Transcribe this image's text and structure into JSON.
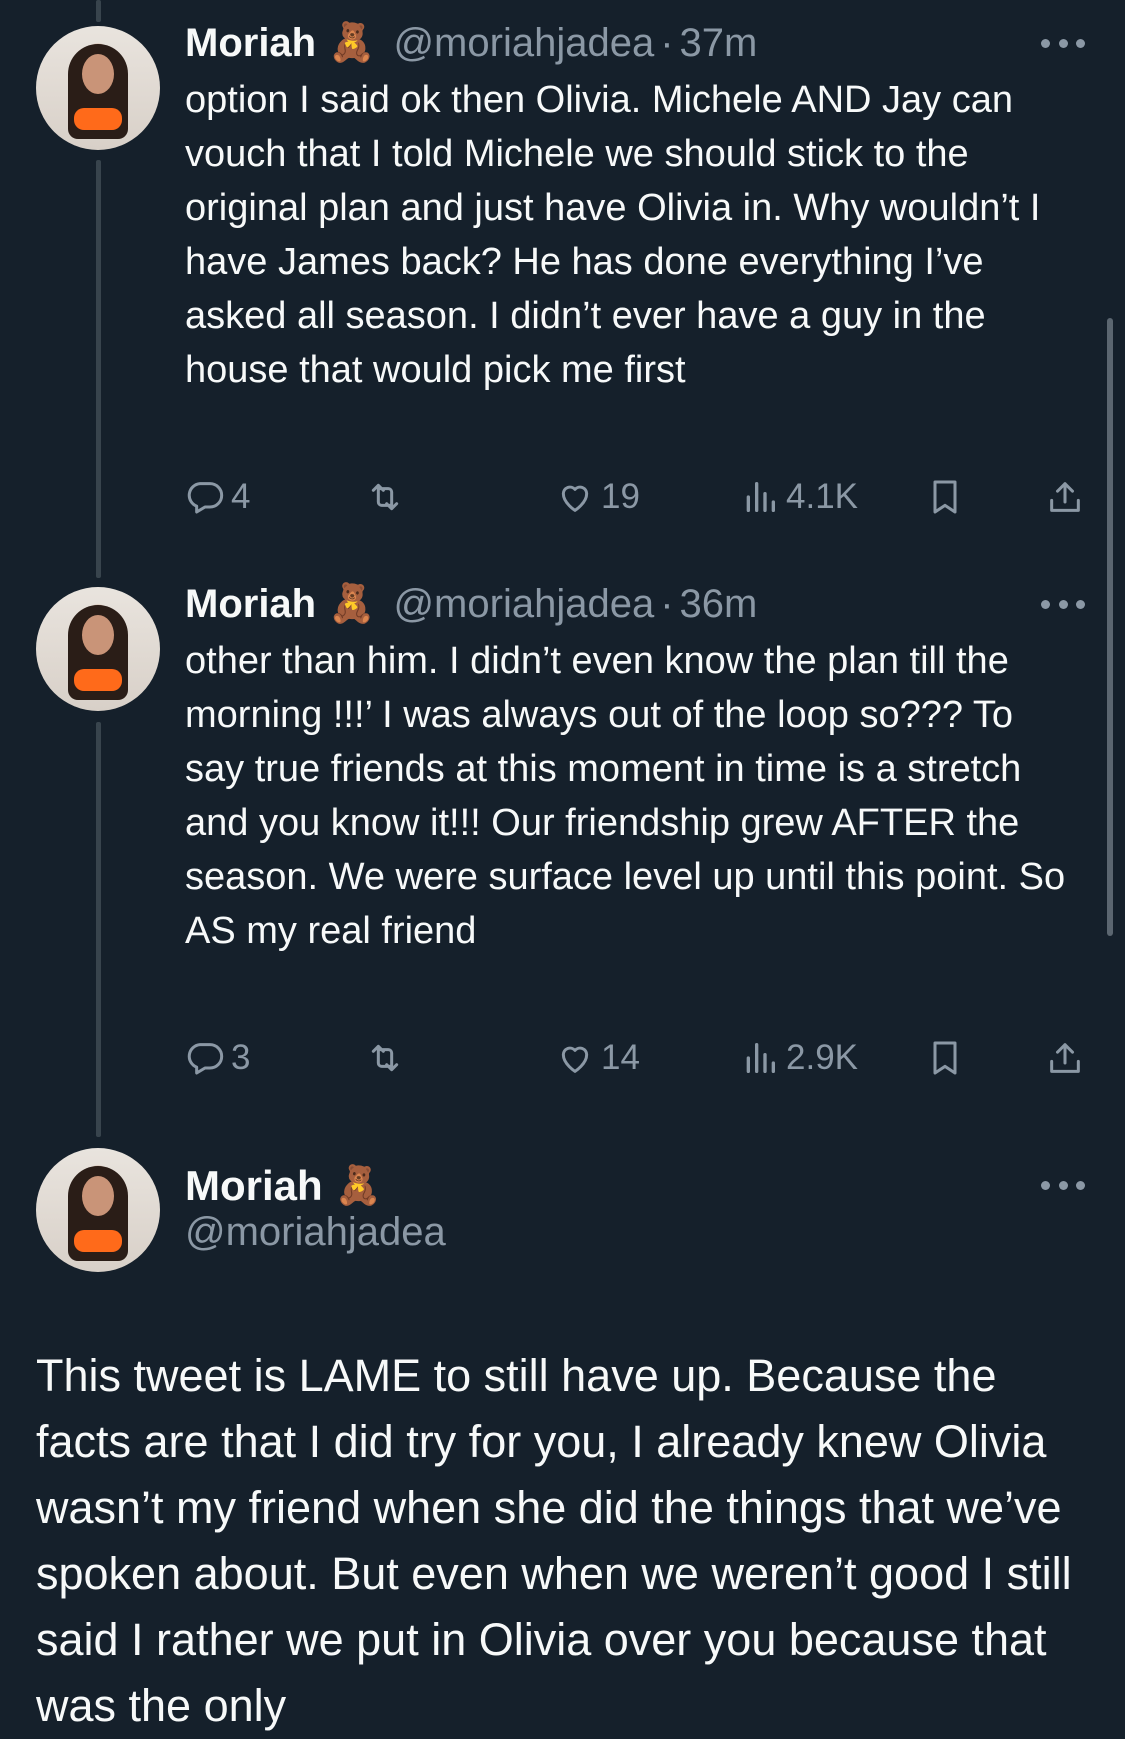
{
  "tweets": [
    {
      "name": "Moriah",
      "emoji": "🧸",
      "handle": "@moriahjadea",
      "separator": "·",
      "time": "37m",
      "text": "option I said ok then Olivia. Michele AND Jay can vouch that I told Michele we should stick to the original plan and just have Olivia in. Why wouldn’t I have James back? He has done everything I’ve asked all season. I didn’t ever have a guy in the house that would pick me first",
      "replies": "4",
      "likes": "19",
      "views": "4.1K"
    },
    {
      "name": "Moriah",
      "emoji": "🧸",
      "handle": "@moriahjadea",
      "separator": "·",
      "time": "36m",
      "text": "other than him. I didn’t even know the plan till the morning !!!’ I was always out of the loop so??? To say true friends at this moment in time is a stretch and you know it!!! Our friendship grew AFTER the season. We were surface level up until this point. So AS my real friend",
      "replies": "3",
      "likes": "14",
      "views": "2.9K"
    }
  ],
  "main_tweet": {
    "name": "Moriah",
    "emoji": "🧸",
    "handle": "@moriahjadea",
    "text": "This tweet is LAME to still have up. Because the facts are that I did try for you, I already knew Olivia wasn’t my friend when she did the things that we’ve spoken about. But even when we weren’t good I still said I rather we put in Olivia over you because that was the only"
  },
  "icons": {
    "reply": "reply-icon",
    "retweet": "retweet-icon",
    "like": "heart-icon",
    "views": "views-icon",
    "bookmark": "bookmark-icon",
    "share": "share-icon",
    "more": "more-icon"
  },
  "colors": {
    "background": "#15202b",
    "text": "#f7f9f9",
    "secondary": "#8b98a5",
    "thread_line": "#38444d"
  }
}
